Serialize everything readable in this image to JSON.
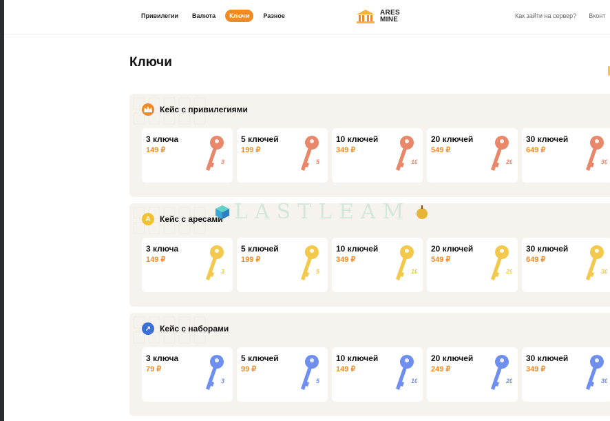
{
  "nav": {
    "items": [
      {
        "label": "Привилегии",
        "active": false
      },
      {
        "label": "Валюта",
        "active": false
      },
      {
        "label": "Ключи",
        "active": true
      },
      {
        "label": "Разное",
        "active": false
      }
    ]
  },
  "logo": {
    "line1": "ARES",
    "line2": "MINE"
  },
  "top_links": [
    "Как зайти на сервер?",
    "Вконт"
  ],
  "page": {
    "title": "Ключи"
  },
  "watermark": "LASTLEAM",
  "colors": {
    "accent": "#f08a24",
    "key_copper": "#e8876a",
    "key_gold": "#f2c94c",
    "key_blue": "#6f8ff0"
  },
  "sections": [
    {
      "title": "Кейс с привилегиями",
      "icon": "crown-icon",
      "icon_color": "#f08a24",
      "key_color": "#e8876a",
      "cards": [
        {
          "title": "3 ключа",
          "price": "149 ₽",
          "badge": "3"
        },
        {
          "title": "5 ключей",
          "price": "199 ₽",
          "badge": "5"
        },
        {
          "title": "10 ключей",
          "price": "349 ₽",
          "badge": "10"
        },
        {
          "title": "20 ключей",
          "price": "549 ₽",
          "badge": "20"
        },
        {
          "title": "30 ключей",
          "price": "649 ₽",
          "badge": "30"
        }
      ]
    },
    {
      "title": "Кейс с аресами",
      "icon": "ares-coin-icon",
      "icon_glyph": "A",
      "icon_color": "#f2c230",
      "key_color": "#f2c94c",
      "cards": [
        {
          "title": "3 ключа",
          "price": "149 ₽",
          "badge": "3"
        },
        {
          "title": "5 ключей",
          "price": "199 ₽",
          "badge": "5"
        },
        {
          "title": "10 ключей",
          "price": "349 ₽",
          "badge": "10"
        },
        {
          "title": "20 ключей",
          "price": "549 ₽",
          "badge": "20"
        },
        {
          "title": "30 ключей",
          "price": "649 ₽",
          "badge": "30"
        }
      ]
    },
    {
      "title": "Кейс с наборами",
      "icon": "arrow-up-right-icon",
      "icon_glyph": "↗",
      "icon_color": "#3b6fd8",
      "key_color": "#6f8ff0",
      "cards": [
        {
          "title": "3 ключа",
          "price": "79 ₽",
          "badge": "3"
        },
        {
          "title": "5 ключей",
          "price": "99 ₽",
          "badge": "5"
        },
        {
          "title": "10 ключей",
          "price": "149 ₽",
          "badge": "10"
        },
        {
          "title": "20 ключей",
          "price": "249 ₽",
          "badge": "20"
        },
        {
          "title": "30 ключей",
          "price": "349 ₽",
          "badge": "30"
        }
      ]
    }
  ]
}
